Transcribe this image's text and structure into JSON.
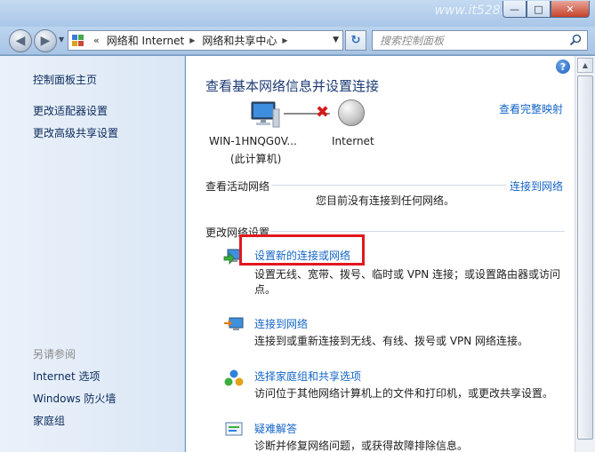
{
  "window": {
    "watermark": "www.it528.com",
    "controls": {
      "minimize": "—",
      "maximize": "□",
      "close": "✕"
    }
  },
  "nav": {
    "back_icon": "back-arrow-icon",
    "forward_icon": "forward-arrow-icon",
    "chevron": "«",
    "breadcrumbs": [
      "网络和 Internet",
      "网络和共享中心"
    ],
    "refresh_glyph": "↻",
    "search_placeholder": "搜索控制面板"
  },
  "sidebar": {
    "links": [
      "控制面板主页",
      "更改适配器设置",
      "更改高级共享设置"
    ],
    "see_also_heading": "另请参阅",
    "see_also": [
      "Internet 选项",
      "Windows 防火墙",
      "家庭组"
    ]
  },
  "main": {
    "help_glyph": "?",
    "title": "查看基本网络信息并设置连接",
    "full_map_link": "查看完整映射",
    "network_map": {
      "computer_name": "WIN-1HNQG0V...",
      "computer_sub": "(此计算机)",
      "internet_label": "Internet",
      "status_glyph": "✖"
    },
    "active_networks": {
      "heading": "查看活动网络",
      "connect_link": "连接到网络",
      "status": "您目前没有连接到任何网络。"
    },
    "change_settings": {
      "heading": "更改网络设置",
      "tasks": [
        {
          "title": "设置新的连接或网络",
          "description": "设置无线、宽带、拨号、临时或 VPN 连接；或设置路由器或访问点。",
          "icon": "new-connection-icon"
        },
        {
          "title": "连接到网络",
          "description": "连接到或重新连接到无线、有线、拨号或 VPN 网络连接。",
          "icon": "connect-network-icon"
        },
        {
          "title": "选择家庭组和共享选项",
          "description": "访问位于其他网络计算机上的文件和打印机，或更改共享设置。",
          "icon": "homegroup-icon"
        },
        {
          "title": "疑难解答",
          "description": "诊断并修复网络问题，或获得故障排除信息。",
          "icon": "troubleshoot-icon"
        }
      ]
    }
  },
  "colors": {
    "link": "#1465c7",
    "title": "#1e3a73",
    "highlight": "#e2171c",
    "sidebar_bg": "#dbe7f5"
  }
}
